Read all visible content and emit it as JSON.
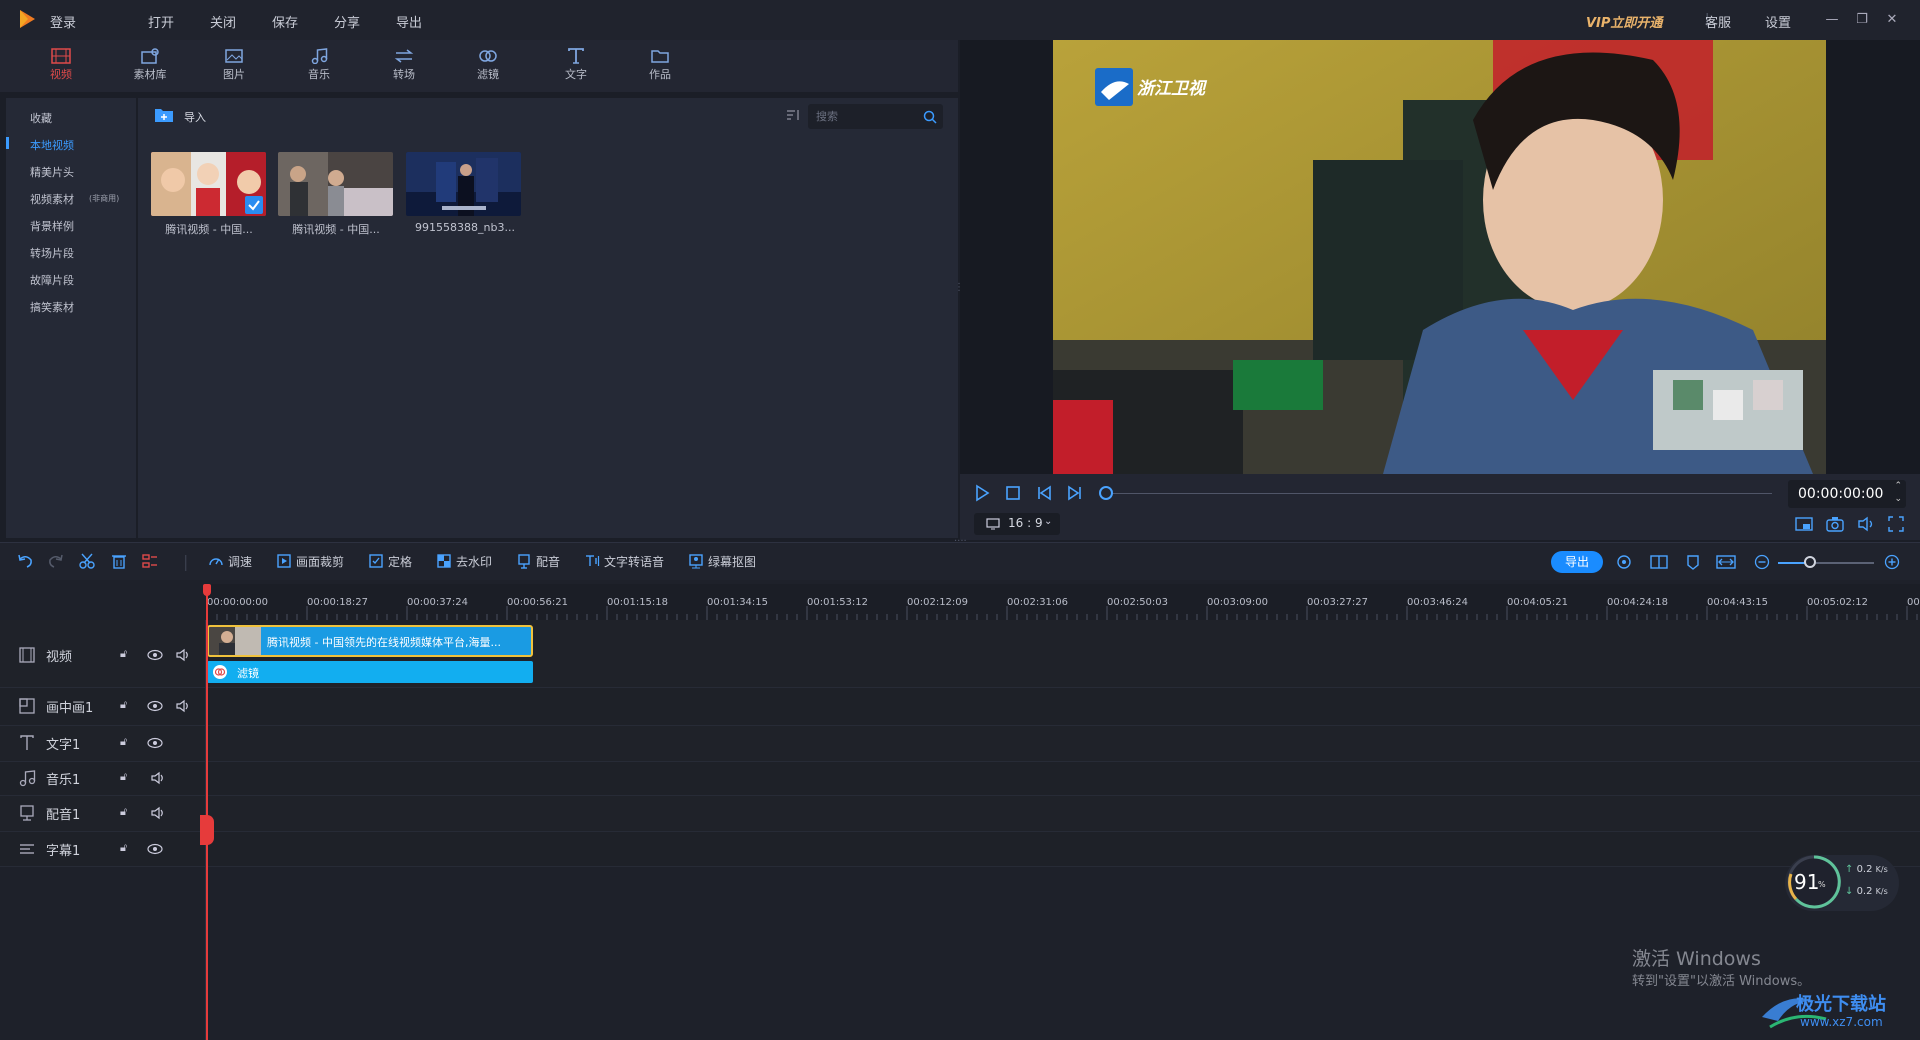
{
  "titlebar": {
    "login": "登录",
    "menu": [
      "打开",
      "关闭",
      "保存",
      "分享",
      "导出"
    ],
    "vip": "VIP立即开通",
    "service": "客服",
    "settings": "设置"
  },
  "tools": [
    {
      "label": "视频",
      "icon": "film-icon"
    },
    {
      "label": "素材库",
      "icon": "library-icon"
    },
    {
      "label": "图片",
      "icon": "image-icon"
    },
    {
      "label": "音乐",
      "icon": "music-icon"
    },
    {
      "label": "转场",
      "icon": "transition-icon"
    },
    {
      "label": "滤镜",
      "icon": "filter-icon"
    },
    {
      "label": "文字",
      "icon": "text-icon"
    },
    {
      "label": "作品",
      "icon": "folder-icon"
    }
  ],
  "sidebar": {
    "items": [
      "收藏",
      "本地视频",
      "精美片头",
      "视频素材",
      "背景样例",
      "转场片段",
      "故障片段",
      "搞笑素材"
    ],
    "badge": "(非商用)"
  },
  "media": {
    "import_label": "导入",
    "search_placeholder": "搜索",
    "items": [
      "腾讯视频 - 中国...",
      "腾讯视频 - 中国...",
      "991558388_nb3..."
    ]
  },
  "preview": {
    "channel_logo": "浙江卫视",
    "timecode": "00:00:00:00",
    "ratio": "16 : 9",
    "progress": 0
  },
  "edit_toolbar": {
    "buttons": [
      "调速",
      "画面裁剪",
      "定格",
      "去水印",
      "配音",
      "文字转语音",
      "绿幕抠图"
    ],
    "export": "导出"
  },
  "ruler": [
    "00:00:00:00",
    "00:00:18:27",
    "00:00:37:24",
    "00:00:56:21",
    "00:01:15:18",
    "00:01:34:15",
    "00:01:53:12",
    "00:02:12:09",
    "00:02:31:06",
    "00:02:50:03",
    "00:03:09:00",
    "00:03:27:27",
    "00:03:46:24",
    "00:04:05:21",
    "00:04:24:18",
    "00:04:43:15",
    "00:05:02:12",
    "00:"
  ],
  "tracks": [
    {
      "name": "视频",
      "icon": "film-icon"
    },
    {
      "name": "画中画1",
      "icon": "pip-icon"
    },
    {
      "name": "文字1",
      "icon": "text-icon"
    },
    {
      "name": "音乐1",
      "icon": "music-icon"
    },
    {
      "name": "配音1",
      "icon": "mic-icon"
    },
    {
      "name": "字幕1",
      "icon": "subtitle-icon"
    }
  ],
  "clips": {
    "video": "腾讯视频 - 中国领先的在线视频媒体平台,海量...",
    "filter": "滤镜"
  },
  "speed": {
    "percent": "91",
    "unit": "%",
    "up": "0.2",
    "down": "0.2",
    "rate_unit": "K/s"
  },
  "watermark": {
    "title": "激活 Windows",
    "subtitle": "转到\"设置\"以激活 Windows。",
    "site": "极光下载站",
    "url": "www.xz7.com"
  },
  "colors": {
    "accent": "#e04a4a",
    "primary": "#1a8cff",
    "clip": "#1a9be3",
    "vip": "#e9b36b"
  }
}
